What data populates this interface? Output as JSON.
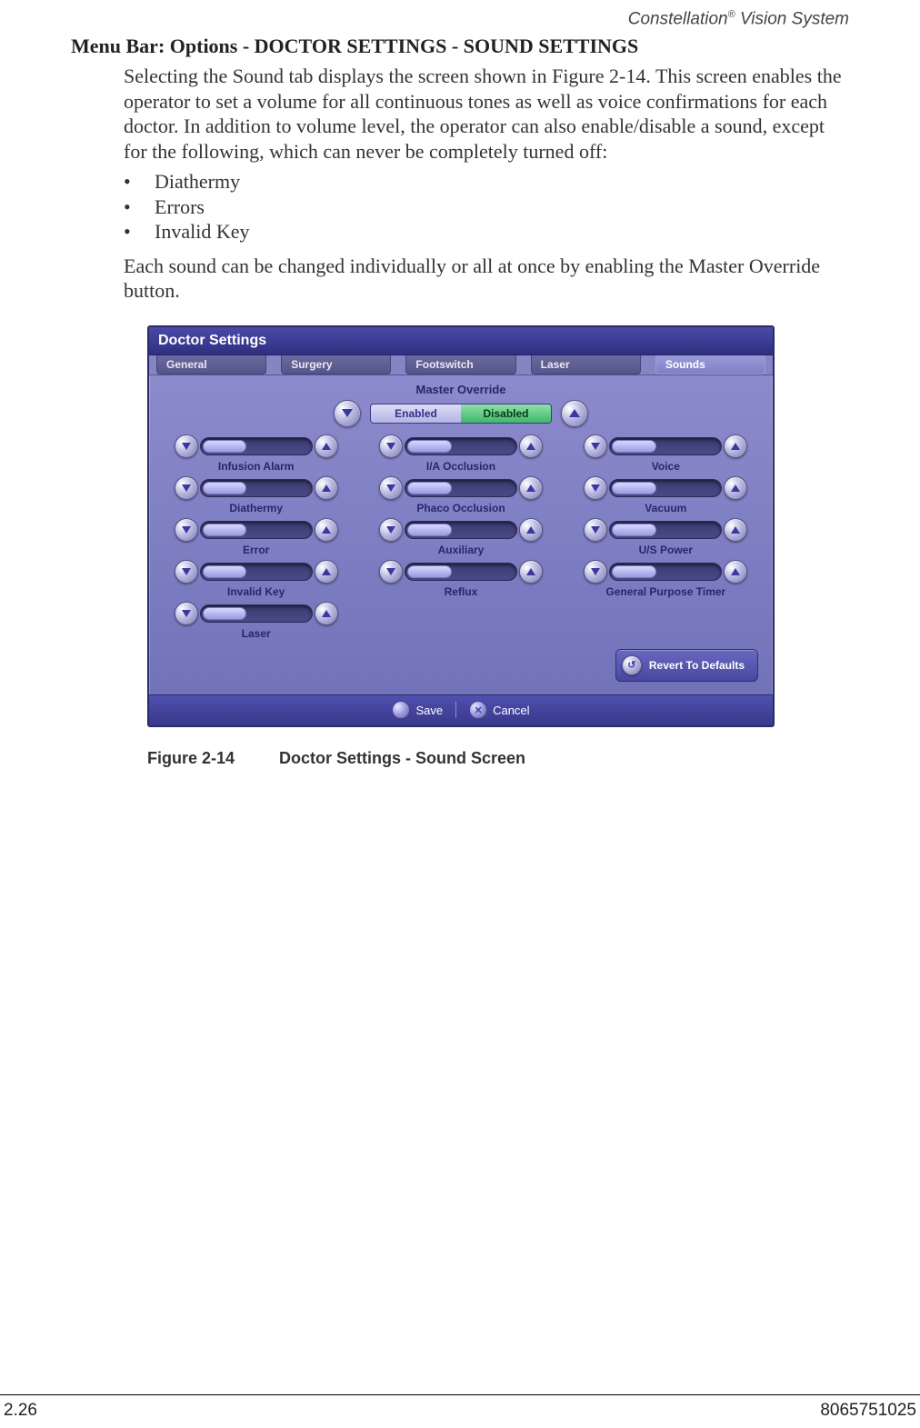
{
  "header": {
    "product": "Constellation",
    "reg": "®",
    "suffix": " Vision System"
  },
  "section_title": "Menu Bar: Options - DOCTOR SETTINGS - SOUND SETTINGS",
  "para1": "Selecting the Sound tab displays the screen shown in Figure 2-14. This screen enables the operator to set a volume for all continuous tones as well as voice confirmations for each doctor. In addition to volume level, the operator can also enable/disable a sound, except for the following, which can never be completely turned off:",
  "bullets": [
    "Diathermy",
    "Errors",
    "Invalid Key"
  ],
  "para2": "Each sound can be changed individually or all at once by enabling the Master Override button.",
  "panel": {
    "title": "Doctor Settings",
    "tabs": [
      "General",
      "Surgery",
      "Footswitch",
      "Laser",
      "Sounds"
    ],
    "active_tab_index": 4,
    "master_override": {
      "label": "Master Override",
      "enabled": "Enabled",
      "disabled": "Disabled"
    },
    "sounds": [
      "Infusion Alarm",
      "I/A Occlusion",
      "Voice",
      "Diathermy",
      "Phaco Occlusion",
      "Vacuum",
      "Error",
      "Auxiliary",
      "U/S Power",
      "Invalid Key",
      "Reflux",
      "General Purpose Timer",
      "Laser"
    ],
    "revert": "Revert To Defaults",
    "save": "Save",
    "cancel": "Cancel"
  },
  "figure": {
    "number": "Figure 2-14",
    "title": "Doctor Settings - Sound Screen"
  },
  "footer": {
    "left": "2.26",
    "right": "8065751025"
  }
}
